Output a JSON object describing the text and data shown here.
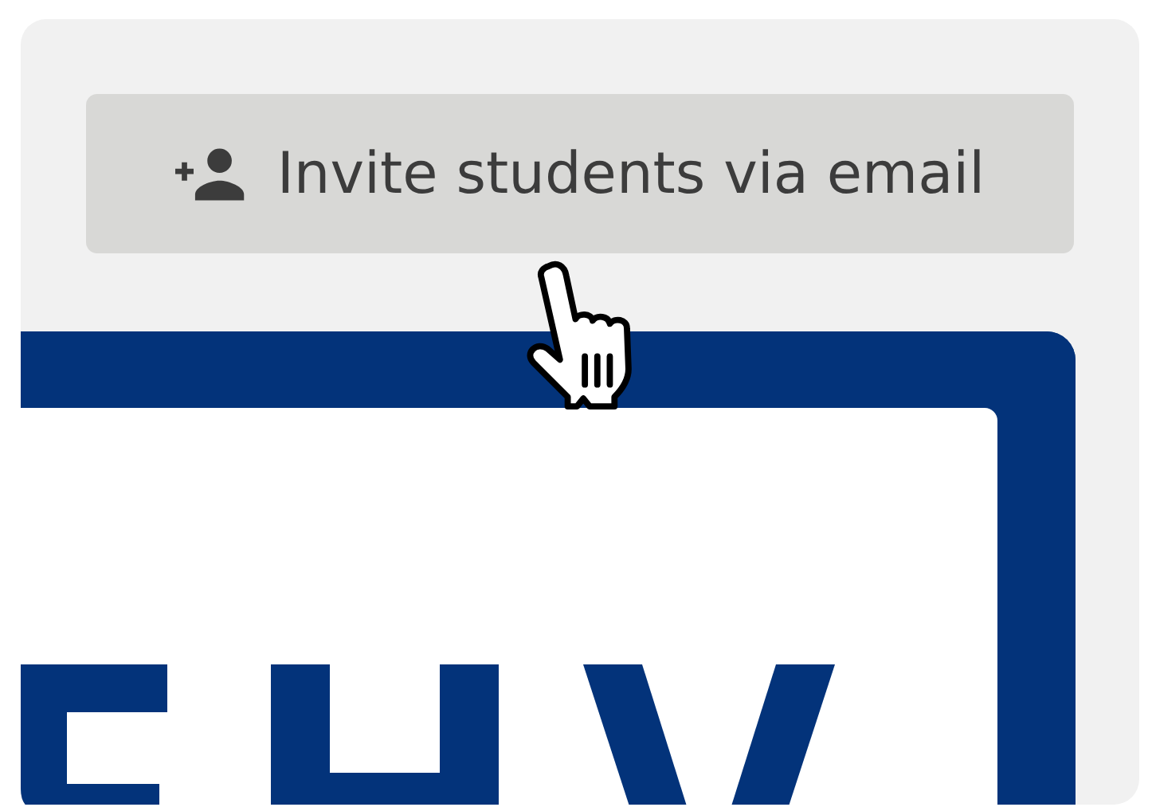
{
  "invite_button": {
    "label": "Invite students via email"
  }
}
